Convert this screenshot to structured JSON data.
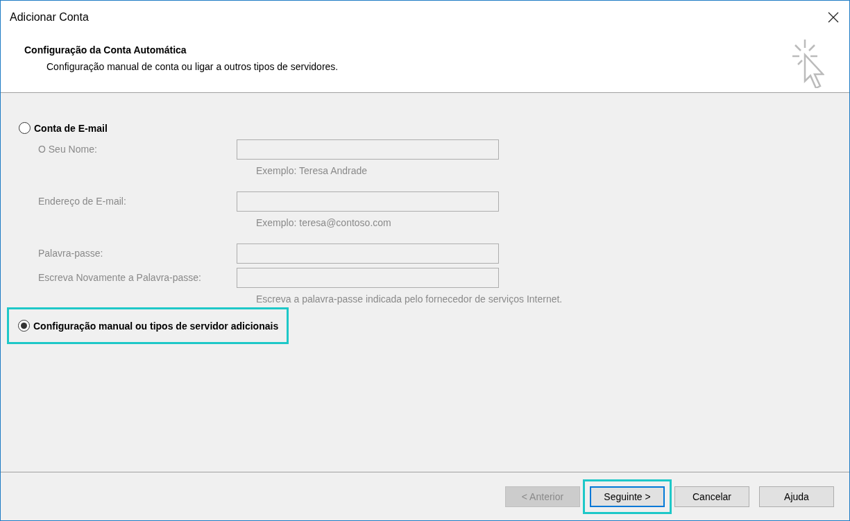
{
  "window": {
    "title": "Adicionar Conta"
  },
  "header": {
    "title": "Configuração da Conta Automática",
    "subtitle": "Configuração manual de conta ou ligar a outros tipos de servidores."
  },
  "options": [
    {
      "label": "Conta de E-mail",
      "selected": false,
      "highlighted": false,
      "fields": [
        {
          "label": "O Seu Nome:",
          "disabled": true,
          "hint": "Exemplo: Teresa Andrade"
        },
        {
          "label": "Endereço de E-mail:",
          "disabled": true,
          "hint": "Exemplo: teresa@contoso.com"
        },
        {
          "label": "Palavra-passe:",
          "disabled": true
        },
        {
          "label": "Escreva Novamente a Palavra-passe:",
          "disabled": true,
          "hint": "Escreva a palavra-passe indicada pelo fornecedor de serviços Internet."
        }
      ]
    },
    {
      "label": "Configuração manual ou tipos de servidor adicionais",
      "selected": true,
      "highlighted": true
    }
  ],
  "buttons": [
    {
      "label": "< Anterior",
      "disabled": true,
      "default": false,
      "highlighted": false
    },
    {
      "label": "Seguinte >",
      "disabled": false,
      "default": true,
      "highlighted": true
    },
    {
      "label": "Cancelar",
      "disabled": false,
      "default": false,
      "highlighted": false
    },
    {
      "label": "Ajuda",
      "disabled": false,
      "default": false,
      "highlighted": false
    }
  ]
}
